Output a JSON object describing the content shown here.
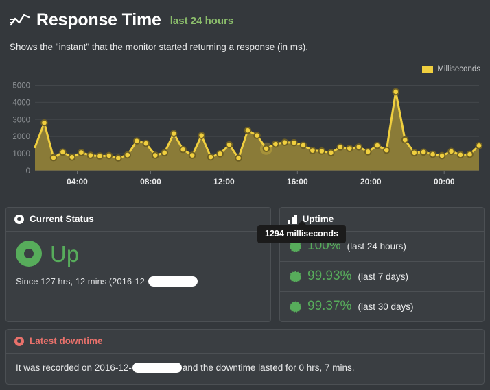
{
  "header": {
    "icon": "line-chart-icon",
    "title": "Response Time",
    "subtitle": "last 24 hours",
    "description": "Shows the \"instant\" that the monitor started returning a response (in ms)."
  },
  "chart_data": {
    "type": "area",
    "title": "Response Time",
    "subtitle": "last 24 hours",
    "xlabel": "",
    "ylabel": "",
    "legend": [
      "Milliseconds"
    ],
    "legend_position": "top-right",
    "legend_color": "#f0cf3f",
    "grid": true,
    "ylim": [
      0,
      5500
    ],
    "yticks": [
      0,
      1000,
      2000,
      3000,
      4000,
      5000
    ],
    "ytick_labels": [
      "0",
      "1000",
      "2000",
      "3000",
      "4000",
      "5000"
    ],
    "xtick_labels": [
      "04:00",
      "08:00",
      "12:00",
      "16:00",
      "20:00",
      "00:00"
    ],
    "xtick_hours": [
      4,
      8,
      12,
      16,
      20,
      24
    ],
    "x_start_hour": 1.7,
    "x_end_hour": 25.9,
    "series": [
      {
        "name": "Milliseconds",
        "line_color": "#f0cf3f",
        "fill_color": "#8a7b38",
        "values": [
          1380,
          2800,
          760,
          1090,
          790,
          1060,
          900,
          860,
          880,
          740,
          920,
          1740,
          1600,
          900,
          1050,
          2180,
          1240,
          900,
          2060,
          800,
          990,
          1520,
          740,
          2360,
          2060,
          1294,
          1560,
          1660,
          1640,
          1490,
          1180,
          1150,
          1050,
          1380,
          1300,
          1390,
          1110,
          1480,
          1200,
          4620,
          1800,
          1050,
          1090,
          960,
          880,
          1130,
          930,
          960,
          1470
        ]
      }
    ],
    "tooltip": {
      "text": "1294 milliseconds",
      "value": 1294,
      "unit": "milliseconds"
    }
  },
  "current_status": {
    "icon": "record-ring-icon",
    "panel_title": "Current Status",
    "status": "Up",
    "status_color": "#57ac5b",
    "since_prefix": "Since 127 hrs, 12 mins (2016-12-",
    "since_redacted": true,
    "since_suffix": ""
  },
  "uptime": {
    "icon": "bar-chart-icon",
    "panel_title": "Uptime",
    "rows": [
      {
        "icon": "burst-badge-icon",
        "value": "100%",
        "label": "(last 24 hours)"
      },
      {
        "icon": "burst-badge-icon",
        "value": "99.93%",
        "label": "(last 7 days)"
      },
      {
        "icon": "burst-badge-icon",
        "value": "99.37%",
        "label": "(last 30 days)"
      }
    ]
  },
  "latest_downtime": {
    "icon": "record-ring-icon",
    "panel_title": "Latest downtime",
    "title_color": "#e8716b",
    "text_prefix": "It was recorded on 2016-12-",
    "text_suffix": " and the downtime lasted for 0 hrs, 7 mins."
  }
}
